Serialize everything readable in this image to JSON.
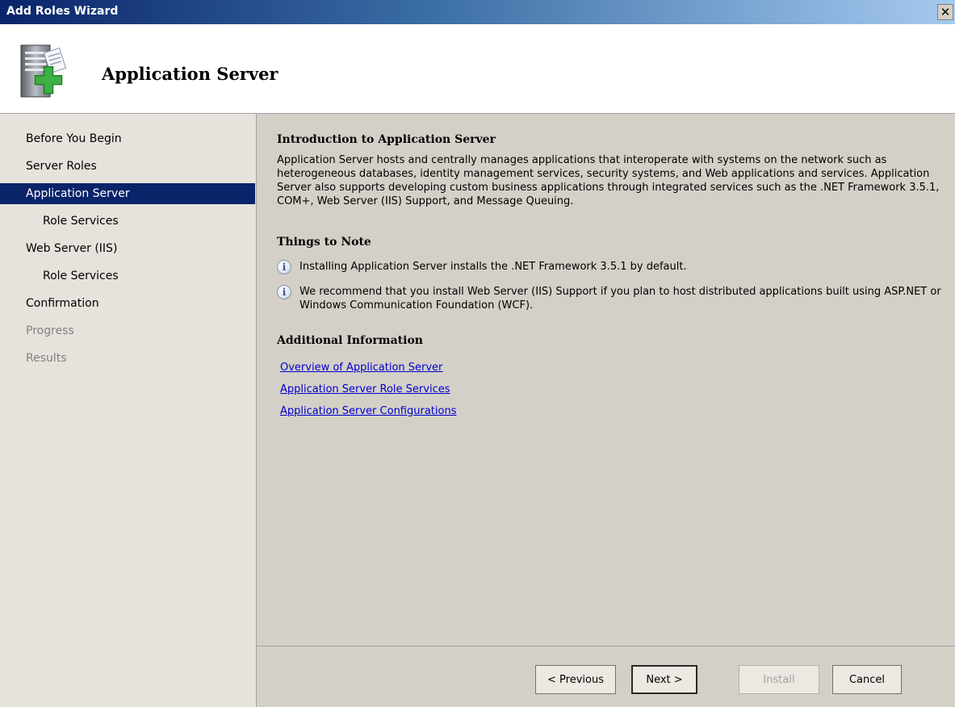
{
  "window": {
    "title": "Add Roles Wizard",
    "close_glyph": "✕"
  },
  "header": {
    "title": "Application Server",
    "icon": "server-add-role-icon"
  },
  "sidebar": {
    "items": [
      {
        "label": "Before You Begin",
        "state": "normal"
      },
      {
        "label": "Server Roles",
        "state": "normal"
      },
      {
        "label": "Application Server",
        "state": "active"
      },
      {
        "label": "Role Services",
        "state": "sub"
      },
      {
        "label": "Web Server (IIS)",
        "state": "normal"
      },
      {
        "label": "Role Services",
        "state": "sub"
      },
      {
        "label": "Confirmation",
        "state": "normal"
      },
      {
        "label": "Progress",
        "state": "disabled"
      },
      {
        "label": "Results",
        "state": "disabled"
      }
    ]
  },
  "content": {
    "intro_heading": "Introduction to Application Server",
    "intro_text": "Application Server hosts and centrally manages applications that interoperate with systems on the network such as heterogeneous databases, identity management services, security systems, and Web applications and services. Application Server also supports developing custom business applications through integrated services such as the .NET Framework 3.5.1, COM+, Web Server (IIS) Support, and Message Queuing.",
    "notes_heading": "Things to Note",
    "notes": [
      "Installing Application Server installs the .NET Framework 3.5.1 by default.",
      "We recommend that you install Web Server (IIS) Support if you plan to host distributed applications built using ASP.NET or Windows Communication Foundation (WCF)."
    ],
    "info_glyph": "i",
    "additional_heading": "Additional Information",
    "links": [
      "Overview of Application Server",
      "Application Server Role Services",
      "Application Server Configurations"
    ]
  },
  "footer": {
    "previous_label": "< Previous",
    "next_label": "Next >",
    "install_label": "Install",
    "cancel_label": "Cancel"
  },
  "colors": {
    "selection": "#0a246a",
    "link": "#0000cc",
    "dialog_face": "#d4d0c8"
  }
}
